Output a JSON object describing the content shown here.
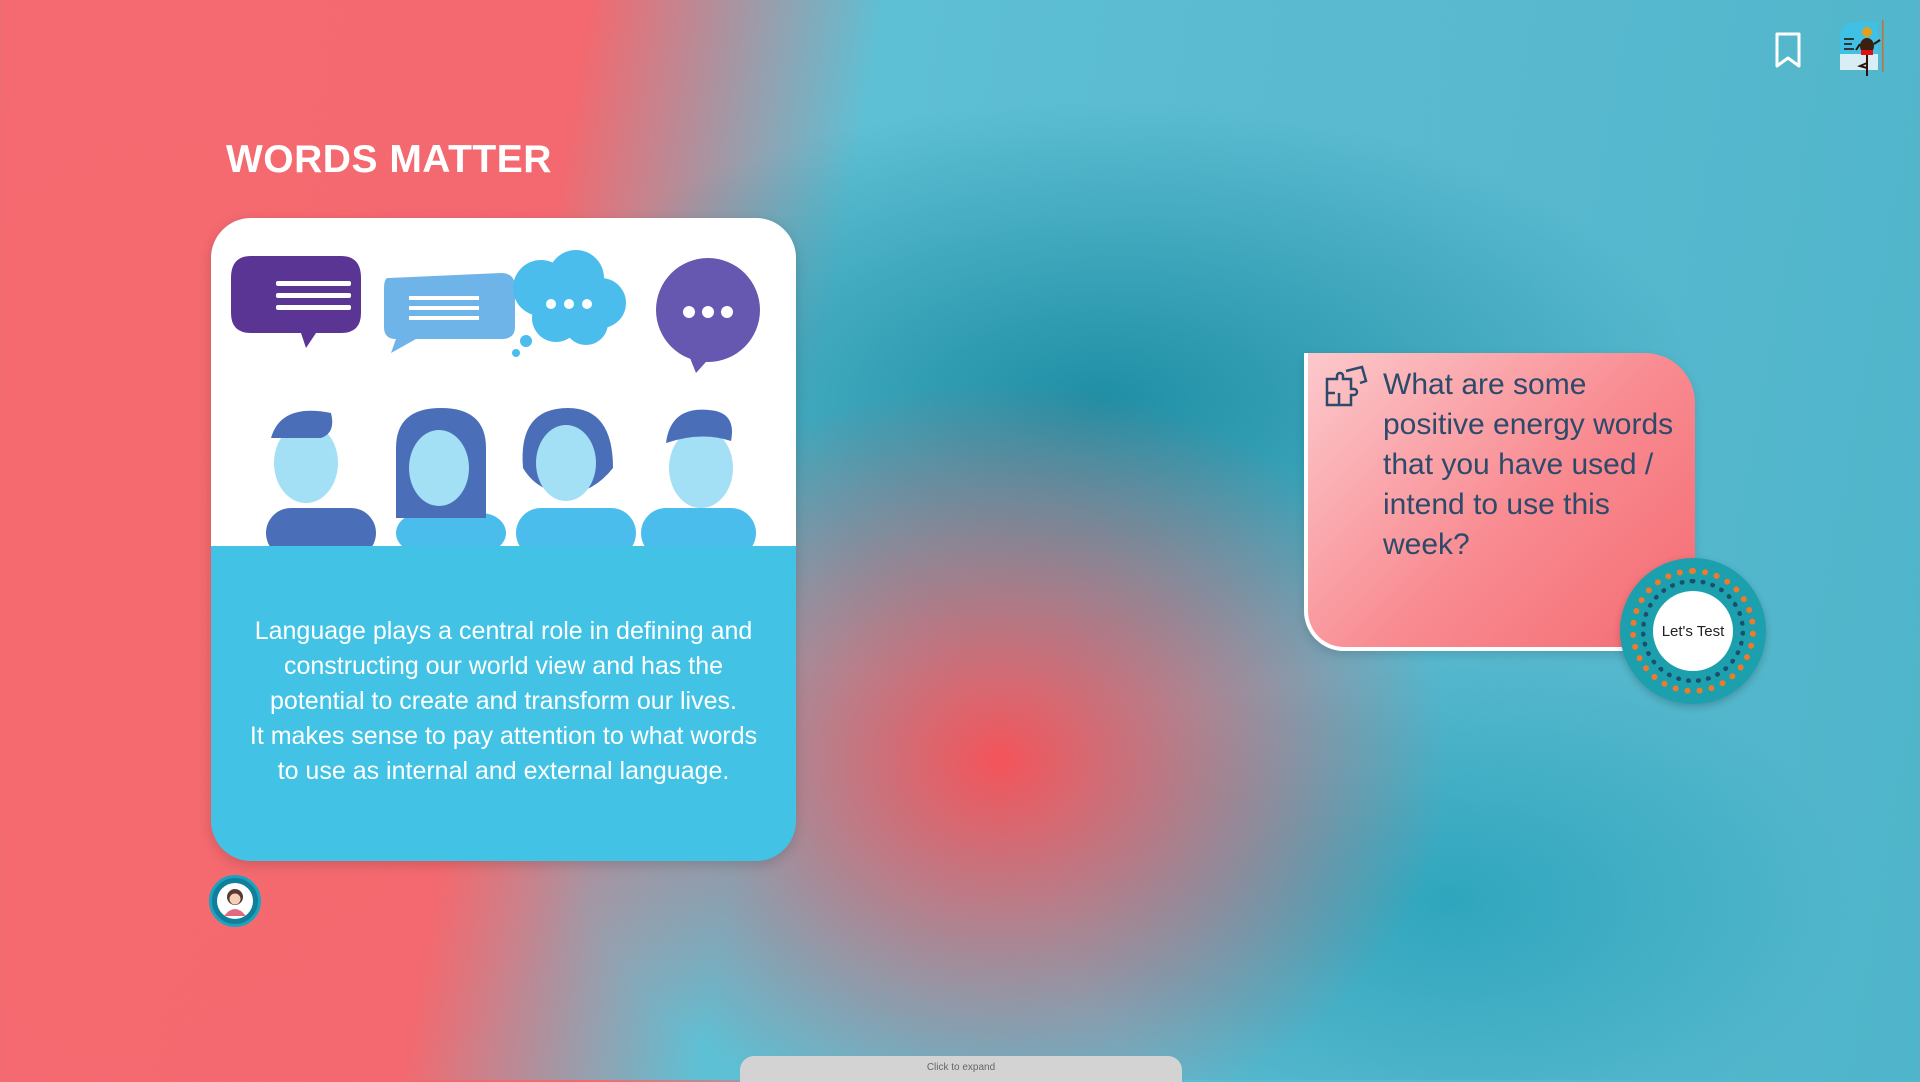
{
  "header": {
    "title": "WORDS MATTER",
    "bookmark_icon": "bookmark-icon",
    "profile_icon": "character-avatar-icon"
  },
  "card": {
    "text_lines": [
      "Language plays a central role in defining and",
      "constructing our world view and has the",
      "potential to create and transform our lives.",
      "It makes sense to pay attention to what words",
      "to use as internal and external language."
    ]
  },
  "question": {
    "text": "What are some positive energy words that you have used / intend to use this week?",
    "button_label": "Let's Test"
  },
  "footer": {
    "expand_label": "Click to expand"
  },
  "colors": {
    "card": "#42c3e6",
    "question_text": "#2e4a6b",
    "accent_orange": "#f07a2a"
  }
}
